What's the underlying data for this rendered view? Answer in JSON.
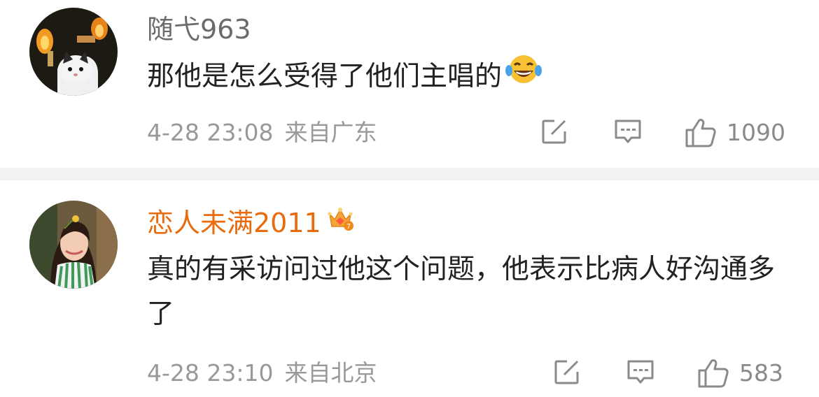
{
  "comments": [
    {
      "username": "随弋963",
      "content": "那他是怎么受得了他们主唱的",
      "content_emoji": "laughing-tears",
      "date": "4-28 23:08",
      "location": "来自广东",
      "likes": "1090",
      "username_color": "#6b6b6b"
    },
    {
      "username": "恋人未满2011",
      "badge": "crown-badge-7",
      "content": "真的有采访问过他这个问题，他表示比病人好沟通多了",
      "date": "4-28 23:10",
      "location": "来自北京",
      "likes": "583",
      "username_color": "#e86b0e"
    }
  ],
  "icons": {
    "share": "share-icon",
    "comment": "comment-icon",
    "like": "thumbs-up-icon"
  }
}
